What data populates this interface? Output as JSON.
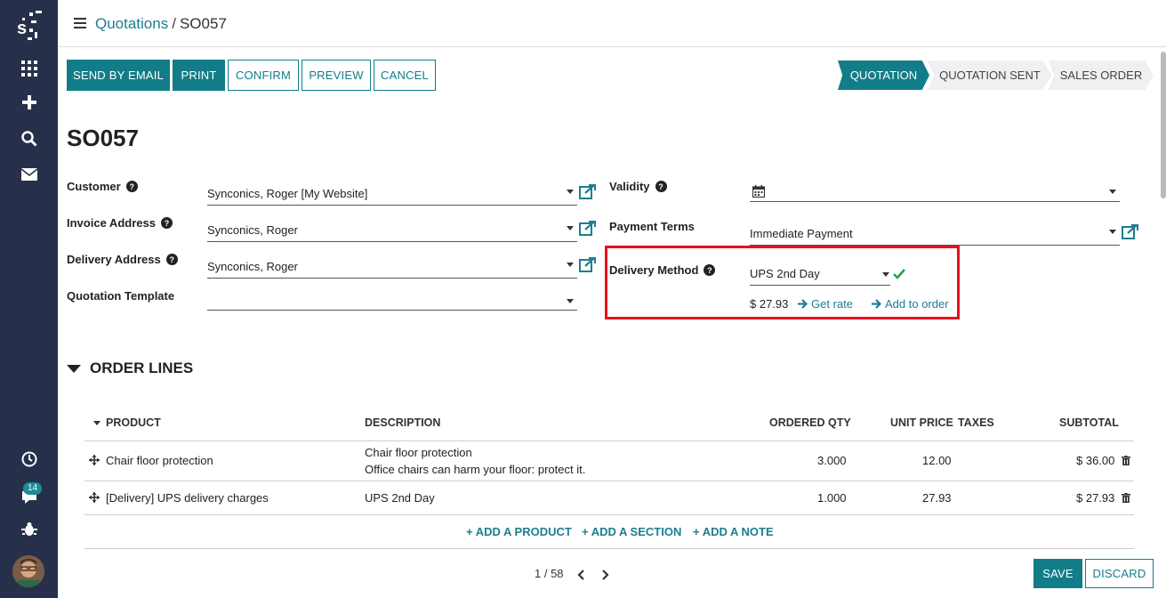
{
  "breadcrumb": {
    "parent": "Quotations",
    "separator": "/",
    "current": "SO057"
  },
  "toolbar": {
    "send_by_email": "SEND BY EMAIL",
    "print": "PRINT",
    "confirm": "CONFIRM",
    "preview": "PREVIEW",
    "cancel": "CANCEL"
  },
  "status": {
    "quotation": "QUOTATION",
    "sent": "QUOTATION SENT",
    "sales_order": "SALES ORDER"
  },
  "record": {
    "title": "SO057"
  },
  "form": {
    "customer_label": "Customer",
    "customer_value": "Synconics, Roger [My Website]",
    "invoice_label": "Invoice Address",
    "invoice_value": "Synconics, Roger",
    "delivery_label": "Delivery Address",
    "delivery_value": "Synconics, Roger",
    "template_label": "Quotation Template",
    "template_value": "",
    "validity_label": "Validity",
    "validity_value": "",
    "terms_label": "Payment Terms",
    "terms_value": "Immediate Payment",
    "method_label": "Delivery Method",
    "method_value": "UPS 2nd Day",
    "rate": "$ 27.93",
    "get_rate": "Get rate",
    "add_to_order": "Add to order"
  },
  "order_lines": {
    "section_title": "ORDER LINES",
    "headers": {
      "product": "PRODUCT",
      "description": "DESCRIPTION",
      "qty": "ORDERED QTY",
      "price": "UNIT PRICE",
      "taxes": "TAXES",
      "subtotal": "SUBTOTAL"
    },
    "rows": [
      {
        "product": "Chair floor protection",
        "desc1": "Chair floor protection",
        "desc2": "Office chairs can harm your floor: protect it.",
        "qty": "3.000",
        "price": "12.00",
        "subtotal": "$ 36.00"
      },
      {
        "product": "[Delivery] UPS delivery charges",
        "desc1": "UPS 2nd Day",
        "desc2": "",
        "qty": "1.000",
        "price": "27.93",
        "subtotal": "$ 27.93"
      }
    ],
    "add_product": "ADD A PRODUCT",
    "add_section": "ADD A SECTION",
    "add_note": "ADD A NOTE"
  },
  "pager": {
    "text": "1 / 58"
  },
  "footer": {
    "save": "SAVE",
    "discard": "DISCARD"
  },
  "sidebar": {
    "badge": "14"
  },
  "colors": {
    "accent": "#127d88",
    "sidebar": "#27304a",
    "highlight": "#e8101d",
    "check": "#1fa34a"
  }
}
